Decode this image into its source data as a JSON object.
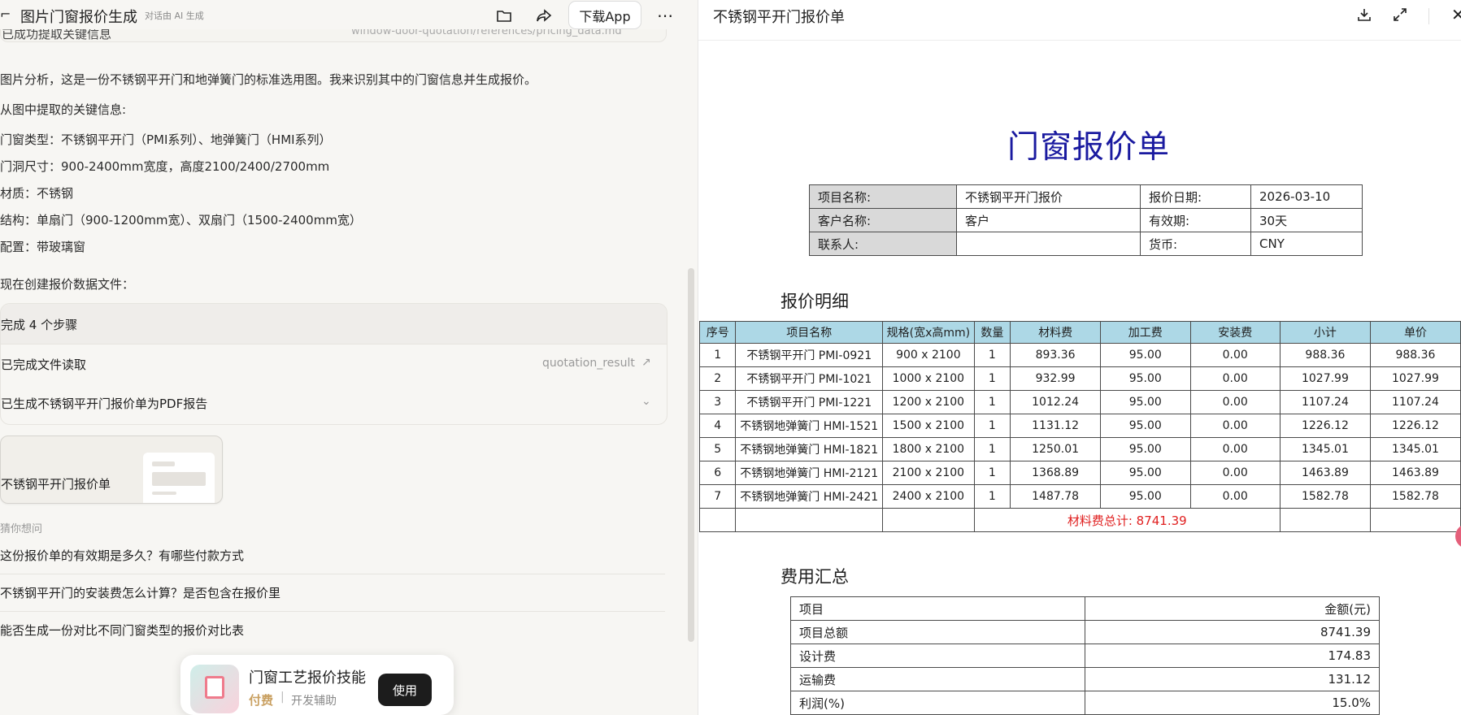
{
  "left": {
    "title": "图片门窗报价生成",
    "subtitle": "对话由 AI 生成",
    "download_app": "下载App",
    "cut_top_left": "已成功提取关键信息",
    "cut_top_right": "window-door-quotation/references/pricing_data.md",
    "paragraphs": [
      "图片分析，这是一份不锈钢平开门和地弹簧门的标准选用图。我来识别其中的门窗信息并生成报价。",
      "从图中提取的关键信息:",
      "门窗类型：不锈钢平开门（PMI系列）、地弹簧门（HMI系列）",
      "门洞尺寸：900-2400mm宽度，高度2100/2400/2700mm",
      "材质：不锈钢",
      "结构：单扇门（900-1200mm宽）、双扇门（1500-2400mm宽）",
      "配置：带玻璃窗",
      "现在创建报价数据文件："
    ],
    "steps": {
      "header": "完成 4 个步骤",
      "rows": [
        {
          "label": "已完成文件读取",
          "file": "quotation_result"
        },
        {
          "label": "已生成不锈钢平开门报价单为PDF报告",
          "file": ""
        }
      ]
    },
    "doc_card": "不锈钢平开门报价单",
    "suggest_label": "猜你想问",
    "suggestions": [
      "这份报价单的有效期是多久？有哪些付款方式",
      "不锈钢平开门的安装费怎么计算？是否包含在报价里",
      "能否生成一份对比不同门窗类型的报价对比表"
    ],
    "skill": {
      "name": "门窗工艺报价技能",
      "paid": "付费",
      "dev": "开发辅助",
      "use": "使用"
    }
  },
  "right": {
    "title": "不锈钢平开门报价单",
    "doc_title": "门窗报价单",
    "meta": [
      [
        "项目名称:",
        "不锈钢平开门报价",
        "报价日期:",
        "2026-03-10"
      ],
      [
        "客户名称:",
        "客户",
        "有效期:",
        "30天"
      ],
      [
        "联系人:",
        "",
        "货币:",
        "CNY"
      ]
    ],
    "section_detail": "报价明细",
    "columns": [
      "序号",
      "项目名称",
      "规格(宽x高mm)",
      "数量",
      "材料费",
      "加工费",
      "安装费",
      "小计",
      "单价"
    ],
    "rows": [
      [
        "1",
        "不锈钢平开门 PMI-0921",
        "900 x 2100",
        "1",
        "893.36",
        "95.00",
        "0.00",
        "988.36",
        "988.36"
      ],
      [
        "2",
        "不锈钢平开门 PMI-1021",
        "1000 x 2100",
        "1",
        "932.99",
        "95.00",
        "0.00",
        "1027.99",
        "1027.99"
      ],
      [
        "3",
        "不锈钢平开门 PMI-1221",
        "1200 x 2100",
        "1",
        "1012.24",
        "95.00",
        "0.00",
        "1107.24",
        "1107.24"
      ],
      [
        "4",
        "不锈钢地弹簧门 HMI-1521",
        "1500 x 2100",
        "1",
        "1131.12",
        "95.00",
        "0.00",
        "1226.12",
        "1226.12"
      ],
      [
        "5",
        "不锈钢地弹簧门 HMI-1821",
        "1800 x 2100",
        "1",
        "1250.01",
        "95.00",
        "0.00",
        "1345.01",
        "1345.01"
      ],
      [
        "6",
        "不锈钢地弹簧门 HMI-2121",
        "2100 x 2100",
        "1",
        "1368.89",
        "95.00",
        "0.00",
        "1463.89",
        "1463.89"
      ],
      [
        "7",
        "不锈钢地弹簧门 HMI-2421",
        "2400 x 2100",
        "1",
        "1487.78",
        "95.00",
        "0.00",
        "1582.78",
        "1582.78"
      ]
    ],
    "material_total": "材料费总计: 8741.39",
    "section_summary": "费用汇总",
    "summary_header": [
      "项目",
      "金额(元)"
    ],
    "summary": [
      [
        "项目总额",
        "8741.39"
      ],
      [
        "设计费",
        "174.83"
      ],
      [
        "运输费",
        "131.12"
      ],
      [
        "利润(%)",
        "15.0%"
      ]
    ]
  }
}
